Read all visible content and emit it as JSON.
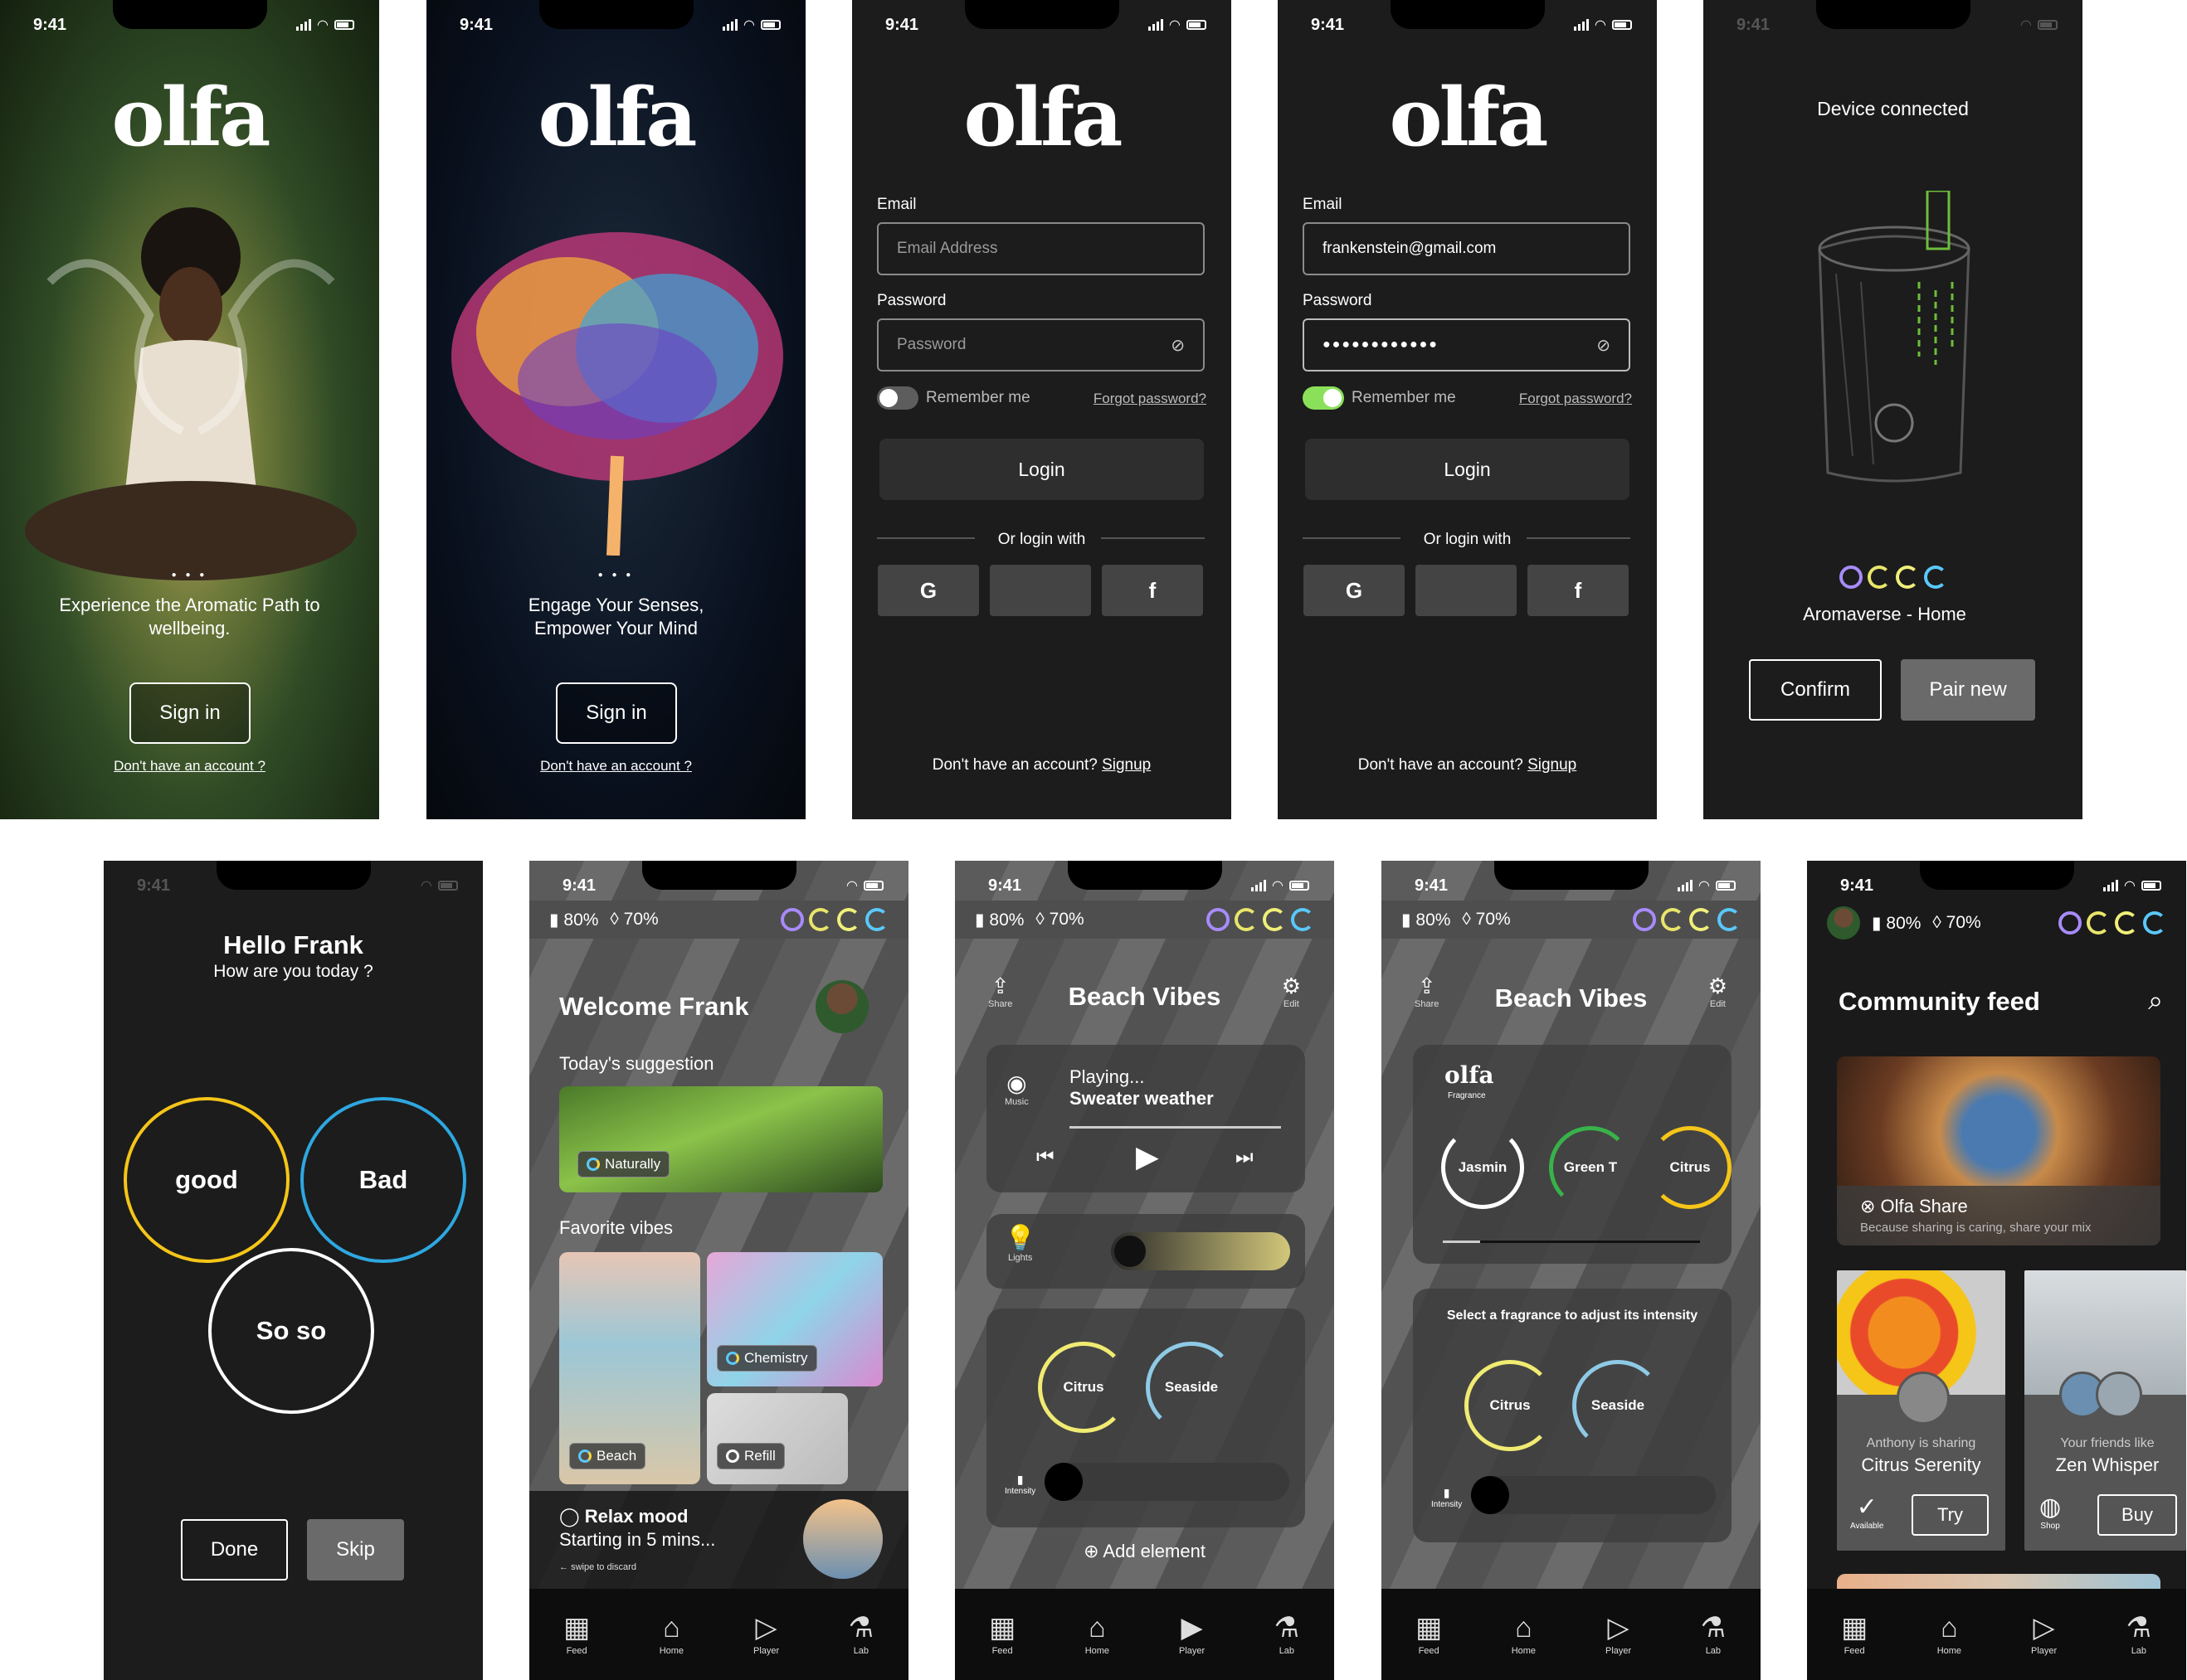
{
  "status": {
    "time": "9:41"
  },
  "screens": {
    "s1": {
      "logo": "olfa",
      "tagline": "Experience the Aromatic Path to wellbeing.",
      "signin": "Sign in",
      "no_account": "Don't have an account ?"
    },
    "s2": {
      "logo": "olfa",
      "tagline": "Engage Your Senses, Empower Your Mind",
      "signin": "Sign in",
      "no_account": "Don't have an account ?"
    },
    "s3": {
      "logo": "olfa",
      "email_label": "Email",
      "email_placeholder": "Email Address",
      "password_label": "Password",
      "password_placeholder": "Password",
      "remember": "Remember me",
      "forgot": "Forgot password?",
      "login": "Login",
      "or": "Or login with",
      "social": [
        "G",
        "",
        "f"
      ],
      "footer": "Don't have an account?",
      "signup": "Signup"
    },
    "s4": {
      "logo": "olfa",
      "email_label": "Email",
      "email_value": "frankenstein@gmail.com",
      "password_label": "Password",
      "password_value": "●●●●●●●●●●●●",
      "remember": "Remember me",
      "forgot": "Forgot password?",
      "login": "Login",
      "or": "Or login with",
      "social": [
        "G",
        "",
        "f"
      ],
      "footer": "Don't have an account?",
      "signup": "Signup"
    },
    "s5": {
      "title": "Device connected",
      "device": "Aromaverse - Home",
      "confirm": "Confirm",
      "pair": "Pair new"
    },
    "s6": {
      "hello": "Hello Frank",
      "question": "How are you today ?",
      "good": "good",
      "bad": "Bad",
      "soso": "So so",
      "done": "Done",
      "skip": "Skip"
    },
    "s7": {
      "battery": "80%",
      "fluid": "70%",
      "welcome": "Welcome Frank",
      "suggestion": "Today's suggestion",
      "naturally": "Naturally",
      "favorites": "Favorite vibes",
      "chemistry": "Chemistry",
      "beach": "Beach",
      "refill": "Refill",
      "relax": "Relax mood",
      "starting": "Starting in 5 mins...",
      "swipe": "swipe to discard"
    },
    "s8": {
      "battery": "80%",
      "fluid": "70%",
      "share": "Share",
      "title": "Beach Vibes",
      "edit": "Edit",
      "music": "Music",
      "playing": "Playing...",
      "song": "Sweater weather",
      "lights": "Lights",
      "citrus": "Citrus",
      "seaside": "Seaside",
      "intensity": "Intensity",
      "add": "Add element"
    },
    "s9": {
      "battery": "80%",
      "fluid": "70%",
      "share": "Share",
      "title": "Beach Vibes",
      "edit": "Edit",
      "brand": "olfa",
      "fragrance": "Fragrance",
      "jasmin": "Jasmin",
      "greent": "Green T",
      "citrus": "Citrus",
      "select": "Select a fragrance to adjust its intensity",
      "citrus2": "Citrus",
      "seaside": "Seaside",
      "intensity": "Intensity"
    },
    "s10": {
      "battery": "80%",
      "fluid": "70%",
      "title": "Community feed",
      "share_title": "Olfa Share",
      "share_sub": "Because sharing is caring, share your mix",
      "anthony": "Anthony is sharing",
      "citrus": "Citrus Serenity",
      "try": "Try",
      "available": "Available",
      "friends": "Your friends like",
      "zen": "Zen Whisper",
      "buy": "Buy",
      "shop": "Shop"
    }
  },
  "tabs": [
    "Feed",
    "Home",
    "Player",
    "Lab"
  ],
  "colors": {
    "ring_purple": "#a78bfa",
    "ring_yellow": "#e8e56b",
    "ring_lime": "#f0f07a",
    "ring_cyan": "#5ac8fa",
    "good": "#f5c518",
    "bad": "#2ea7e0",
    "toggle_on": "#8be05a"
  }
}
